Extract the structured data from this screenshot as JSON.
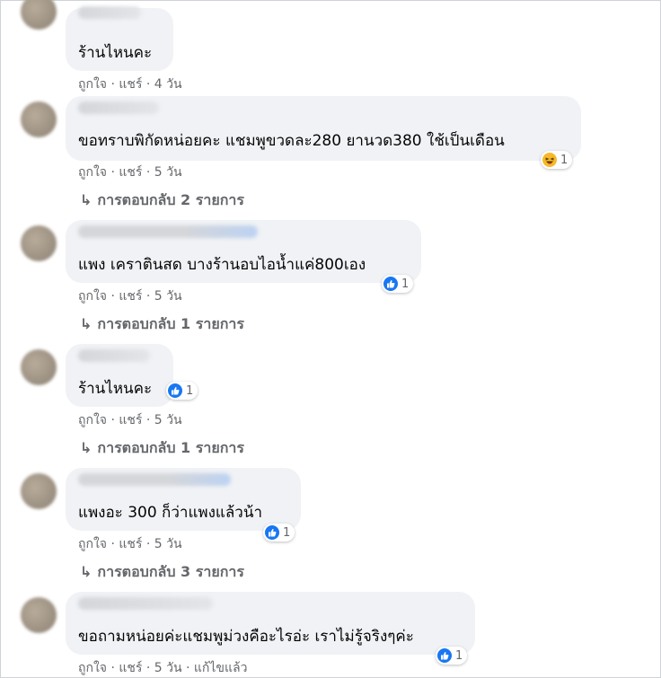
{
  "comments": [
    {
      "text": "ร้านไหนคะ",
      "meta": "ถูกใจ · แชร์ · 4 วัน",
      "reaction": null,
      "reply": null
    },
    {
      "text": "ขอทราบพิกัดหน่อยคะ แชมพูขวดละ280 ยานวด380 ใช้เป็นเดือน",
      "meta": "ถูกใจ · แชร์ · 5 วัน",
      "reaction": {
        "icon": "haha-icon",
        "count": "1"
      },
      "reply": "การตอบกลับ 2 รายการ"
    },
    {
      "text": "แพง เคราตินสด บางร้านอบไอน้ำแค่800เอง",
      "meta": "ถูกใจ · แชร์ · 5 วัน",
      "reaction": {
        "icon": "like-icon",
        "count": "1"
      },
      "reply": "การตอบกลับ 1 รายการ"
    },
    {
      "text": "ร้านไหนคะ",
      "meta": "ถูกใจ · แชร์ · 5 วัน",
      "reaction": {
        "icon": "like-icon",
        "count": "1"
      },
      "reply": "การตอบกลับ 1 รายการ"
    },
    {
      "text": "แพงอะ 300 ก็ว่าแพงแล้วน้า",
      "meta": "ถูกใจ · แชร์ · 5 วัน",
      "reaction": {
        "icon": "like-icon",
        "count": "1"
      },
      "reply": "การตอบกลับ 3 รายการ"
    },
    {
      "text": "ขอถามหน่อยค่ะแชมพูม่วงคือะไรอ่ะ เราไม่รู้จริงๆค่ะ",
      "meta": "ถูกใจ · แชร์ · 5 วัน · แก้ไขแล้ว",
      "reaction": {
        "icon": "like-icon",
        "count": "1"
      },
      "reply": null
    }
  ],
  "colors": {
    "bubble": "#f0f2f5",
    "meta": "#65676b",
    "like": "#1877f2",
    "haha": "#f7b928"
  }
}
